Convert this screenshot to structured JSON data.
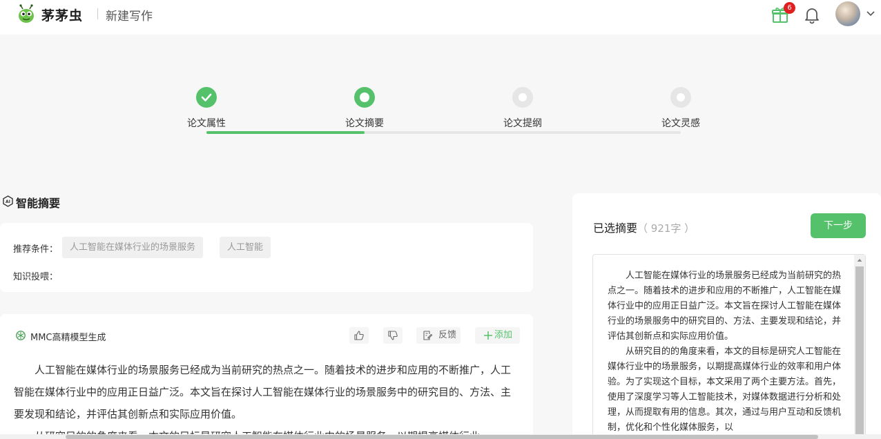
{
  "header": {
    "brand": "茅茅虫",
    "subtitle": "新建写作",
    "gift_badge_count": "6",
    "icons": [
      "bug-logo-icon",
      "gift-icon",
      "bell-icon",
      "avatar",
      "chevron-down-icon"
    ]
  },
  "steps": {
    "items": [
      {
        "label": "论文属性",
        "status": "done"
      },
      {
        "label": "论文摘要",
        "status": "active"
      },
      {
        "label": "论文提纲",
        "status": "pending"
      },
      {
        "label": "论文灵感",
        "status": "pending"
      }
    ],
    "progress": 0.333
  },
  "section": {
    "title": "智能摘要",
    "icon": "ai-icon"
  },
  "conditions": {
    "recommend_label": "推荐条件：",
    "tags": [
      "人工智能在媒体行业的场景服务",
      "人工智能"
    ],
    "knowledge_label": "知识投喂："
  },
  "result": {
    "model_name": "MMC高精模型生成",
    "actions": {
      "like_icon": "thumbs-up-icon",
      "dislike_icon": "thumbs-down-icon",
      "feedback_label": "反馈",
      "add_label": "添加"
    },
    "paragraphs": [
      "人工智能在媒体行业的场景服务已经成为当前研究的热点之一。随着技术的进步和应用的不断推广，人工智能在媒体行业中的应用正日益广泛。本文旨在探讨人工智能在媒体行业的场景服务中的研究目的、方法、主要发现和结论，并评估其创新点和实际应用价值。",
      "从研究目的的角度来看，本文的目标是研究人工智能在媒体行业中的场景服务，以期提高媒体行业"
    ]
  },
  "selected": {
    "title": "已选摘要",
    "count": "（ 921字 ）",
    "next_button": "下一步",
    "paragraphs": [
      "人工智能在媒体行业的场景服务已经成为当前研究的热点之一。随着技术的进步和应用的不断推广，人工智能在媒体行业中的应用正日益广泛。本文旨在探讨人工智能在媒体行业的场景服务中的研究目的、方法、主要发现和结论，并评估其创新点和实际应用价值。",
      "从研究目的的角度来看，本文的目标是研究人工智能在媒体行业中的场景服务，以期提高媒体行业的效率和用户体验。为了实现这个目标，本文采用了两个主要方法。首先，使用了深度学习等人工智能技术，对媒体数据进行分析和处理，从而提取有用的信息。其次，通过与用户互动和反馈机制，优化和个性化媒体服务，以"
    ]
  },
  "colors": {
    "accent": "#55c26b",
    "step_pending": "#e6e6e6",
    "badge": "#e02020"
  }
}
